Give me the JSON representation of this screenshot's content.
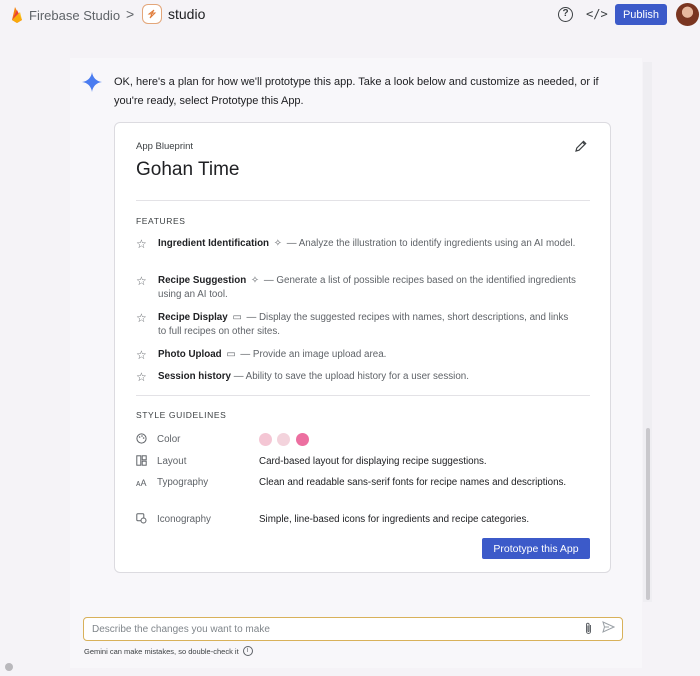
{
  "topbar": {
    "brand_name": "Firebase Studio",
    "separator": ">",
    "project_name": "studio",
    "help_icon": "help-circle-icon",
    "code_icon": "code-icon",
    "publish_label": "Publish"
  },
  "chat": {
    "message": "OK, here's a plan for how we'll prototype this app. Take a look below and customize as needed, or if you're ready, select Prototype this App."
  },
  "blueprint": {
    "kicker": "App Blueprint",
    "title": "Gohan Time",
    "features_label": "FEATURES",
    "features": [
      {
        "name": "Ingredient Identification",
        "icon": "sparkle-icon",
        "description": "— Analyze the illustration to identify ingredients using an AI model."
      },
      {
        "name": "Recipe Suggestion",
        "icon": "sparkle-icon",
        "description": "— Generate a list of possible recipes based on the identified ingredients using an AI tool."
      },
      {
        "name": "Recipe Display",
        "icon": "window-icon",
        "description": "— Display the suggested recipes with names, short descriptions, and links to full recipes on other sites."
      },
      {
        "name": "Photo Upload",
        "icon": "window-icon",
        "description": "— Provide an image upload area."
      },
      {
        "name": "Session history",
        "icon": "",
        "description": "— Ability to save the upload history for a user session."
      }
    ],
    "style_label": "STYLE GUIDELINES",
    "style": {
      "color_label": "Color",
      "colors": [
        "#f4c6d4",
        "#f3d3dc",
        "#ec6fa0"
      ],
      "layout_label": "Layout",
      "layout_value": "Card-based layout for displaying recipe suggestions.",
      "typography_label": "Typography",
      "typography_value": "Clean and readable sans-serif fonts for recipe names and descriptions.",
      "iconography_label": "Iconography",
      "iconography_value": "Simple, line-based icons for ingredients and recipe categories."
    },
    "prototype_label": "Prototype this App"
  },
  "prompt": {
    "placeholder": "Describe the changes you want to make",
    "value": "",
    "disclaimer": "Gemini can make mistakes, so double-check it"
  }
}
